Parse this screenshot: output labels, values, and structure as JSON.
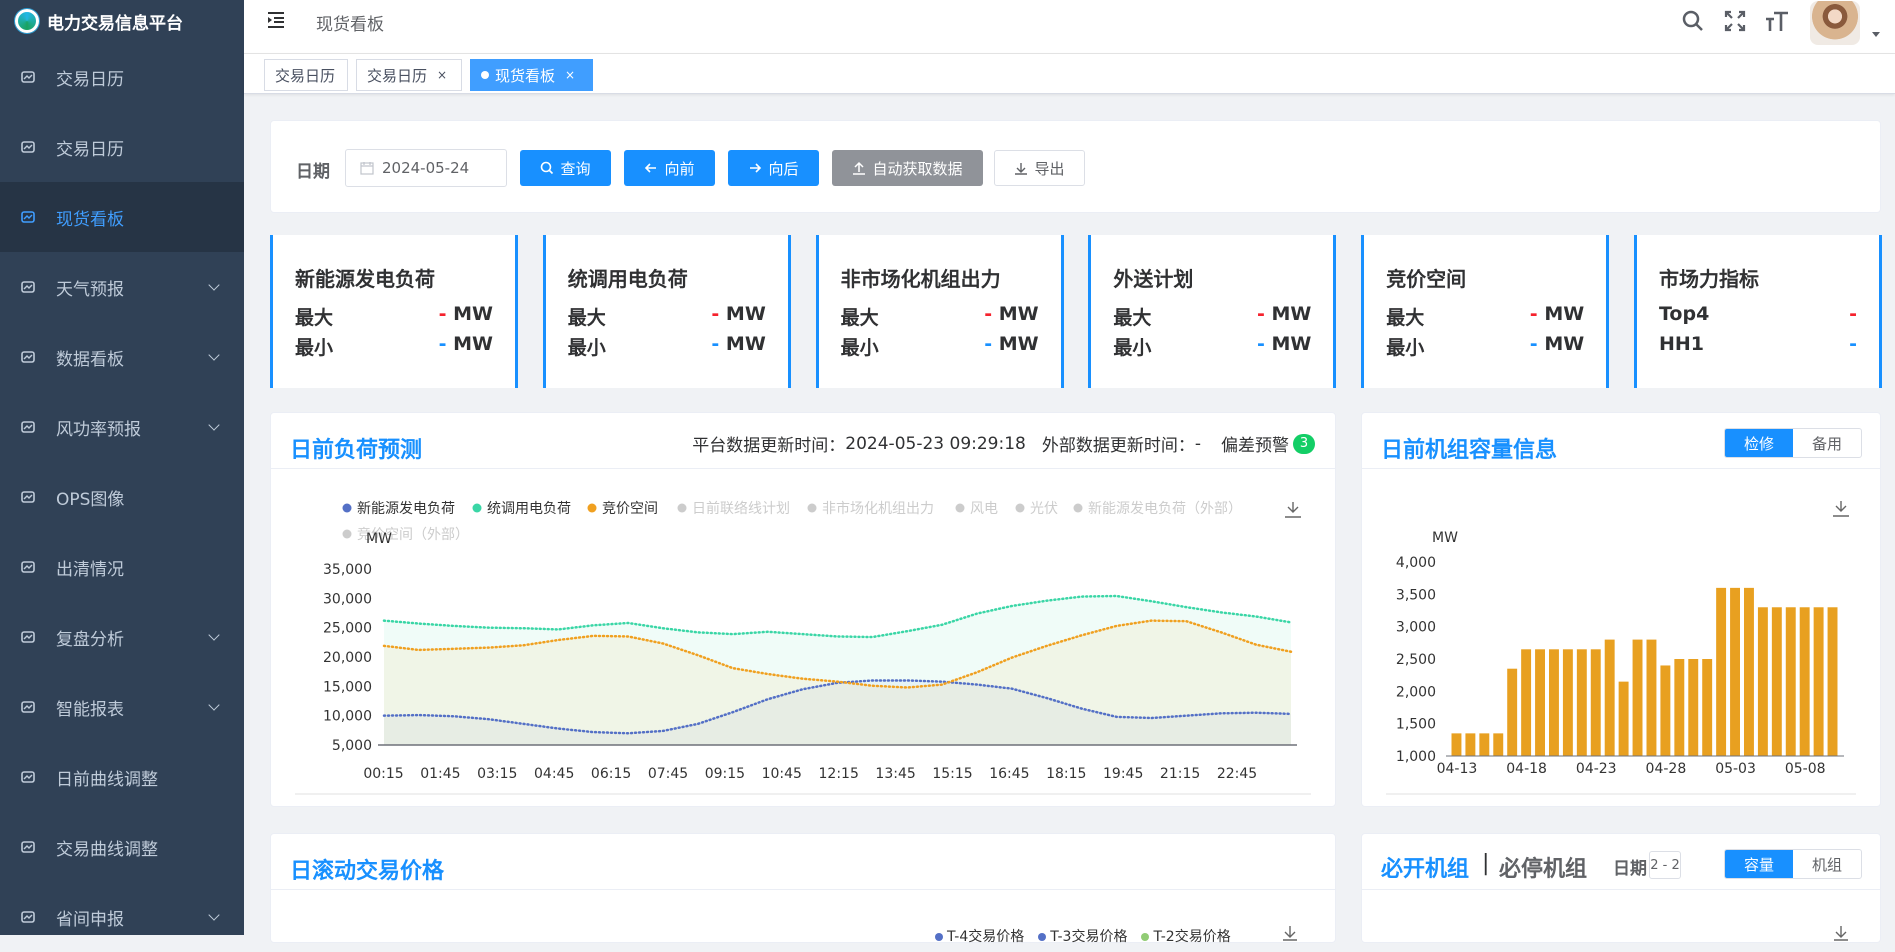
{
  "app": {
    "title": "电力交易信息平台"
  },
  "sidebar": {
    "items": [
      {
        "label": "交易日历",
        "icon": "dashboard-icon",
        "expandable": false
      },
      {
        "label": "交易日历",
        "icon": "calendar-icon",
        "expandable": false
      },
      {
        "label": "现货看板",
        "icon": "image-icon",
        "expandable": false,
        "active": true
      },
      {
        "label": "天气预报",
        "icon": "send-icon",
        "expandable": true
      },
      {
        "label": "数据看板",
        "icon": "list-icon",
        "expandable": true
      },
      {
        "label": "风功率预报",
        "icon": "globe-icon",
        "expandable": true
      },
      {
        "label": "OPS图像",
        "icon": "document-icon",
        "expandable": false
      },
      {
        "label": "出清情况",
        "icon": "checkbox-icon",
        "expandable": false
      },
      {
        "label": "复盘分析",
        "icon": "tree-icon",
        "expandable": true
      },
      {
        "label": "智能报表",
        "icon": "report-icon",
        "expandable": true
      },
      {
        "label": "日前曲线调整",
        "icon": "bar-chart-icon",
        "expandable": false
      },
      {
        "label": "交易曲线调整",
        "icon": "bar-chart-icon",
        "expandable": false
      },
      {
        "label": "省间申报",
        "icon": "table-icon",
        "expandable": true
      }
    ]
  },
  "header": {
    "breadcrumb": "现货看板"
  },
  "tags": [
    {
      "label": "交易日历",
      "closable": false
    },
    {
      "label": "交易日历",
      "closable": true
    },
    {
      "label": "现货看板",
      "closable": true,
      "active": true
    }
  ],
  "filter": {
    "date_label": "日期",
    "date_value": "2024-05-24",
    "query": "查询",
    "prev": "向前",
    "next": "向后",
    "auto_fetch": "自动获取数据",
    "export": "导出"
  },
  "stats": [
    {
      "title": "新能源发电负荷",
      "r1": "最大",
      "r1v": "-",
      "r2": "最小",
      "r2v": "-",
      "unit": "MW"
    },
    {
      "title": "统调用电负荷",
      "r1": "最大",
      "r1v": "-",
      "r2": "最小",
      "r2v": "-",
      "unit": "MW"
    },
    {
      "title": "非市场化机组出力",
      "r1": "最大",
      "r1v": "-",
      "r2": "最小",
      "r2v": "-",
      "unit": "MW"
    },
    {
      "title": "外送计划",
      "r1": "最大",
      "r1v": "-",
      "r2": "最小",
      "r2v": "-",
      "unit": "MW"
    },
    {
      "title": "竞价空间",
      "r1": "最大",
      "r1v": "-",
      "r2": "最小",
      "r2v": "-",
      "unit": "MW"
    },
    {
      "title": "市场力指标",
      "r1": "Top4",
      "r1v": "-",
      "r2": "HH1",
      "r2v": "-",
      "unit": ""
    }
  ],
  "load_panel": {
    "title": "日前负荷预测",
    "update_label": "平台数据更新时间：",
    "update_time": "2024-05-23 09:29:18",
    "ext_label": "外部数据更新时间：",
    "ext_time": "-",
    "warn_label": "偏差预警",
    "warn_count": "3"
  },
  "capacity_panel": {
    "title": "日前机组容量信息",
    "seg": [
      "检修",
      "备用"
    ]
  },
  "price_panel": {
    "title": "日滚动交易价格",
    "legend": [
      "T-4交易价格",
      "T-3交易价格",
      "T-2交易价格"
    ]
  },
  "unit_panel": {
    "title_a": "必开机组",
    "sep": "|",
    "title_b": "必停机组",
    "date_label": "日期",
    "date_value": "2 - 2",
    "seg": [
      "容量",
      "机组"
    ]
  },
  "chart_data": [
    {
      "type": "line",
      "ylabel": "MW",
      "ylim": [
        5000,
        35000
      ],
      "yticks": [
        "5,000",
        "10,000",
        "15,000",
        "20,000",
        "25,000",
        "30,000",
        "35,000"
      ],
      "x_ticks": [
        "00:15",
        "01:45",
        "03:15",
        "04:45",
        "06:15",
        "07:45",
        "09:15",
        "10:45",
        "12:15",
        "13:45",
        "15:15",
        "16:45",
        "18:15",
        "19:45",
        "21:15",
        "22:45"
      ],
      "legend": [
        {
          "name": "新能源发电负荷",
          "color": "#5470c6",
          "active": true
        },
        {
          "name": "统调用电负荷",
          "color": "#3ad6a6",
          "active": true
        },
        {
          "name": "竞价空间",
          "color": "#f0a020",
          "active": true
        },
        {
          "name": "日前联络线计划",
          "color": "#cccccc",
          "active": false
        },
        {
          "name": "非市场化机组出力",
          "color": "#cccccc",
          "active": false
        },
        {
          "name": "风电",
          "color": "#cccccc",
          "active": false
        },
        {
          "name": "光伏",
          "color": "#cccccc",
          "active": false
        },
        {
          "name": "新能源发电负荷（外部）",
          "color": "#cccccc",
          "active": false
        },
        {
          "name": "竞价空间（外部）",
          "color": "#cccccc",
          "active": false
        }
      ],
      "series": [
        {
          "name": "新能源发电负荷",
          "color": "#5470c6",
          "values": [
            10000,
            10100,
            9900,
            9400,
            8600,
            7800,
            7200,
            7000,
            7400,
            8600,
            10600,
            12800,
            14500,
            15600,
            16000,
            16000,
            15800,
            15300,
            14600,
            13000,
            11200,
            9800,
            9600,
            10000,
            10400,
            10500,
            10300
          ]
        },
        {
          "name": "统调用电负荷",
          "color": "#3ad6a6",
          "values": [
            26200,
            25700,
            25300,
            25000,
            24900,
            24700,
            25400,
            25800,
            24900,
            24200,
            23900,
            24300,
            23900,
            23500,
            23400,
            24400,
            25500,
            27400,
            28700,
            29600,
            30300,
            30400,
            29500,
            28500,
            27600,
            26900,
            25900
          ]
        },
        {
          "name": "竞价空间",
          "color": "#f0a020",
          "values": [
            21900,
            21200,
            21400,
            21600,
            22000,
            22900,
            23600,
            23500,
            22300,
            20300,
            18100,
            17100,
            16300,
            15800,
            15100,
            14800,
            15300,
            17400,
            19900,
            21900,
            23700,
            25300,
            26200,
            26100,
            24200,
            22100,
            20900
          ]
        }
      ]
    },
    {
      "type": "bar",
      "ylabel": "MW",
      "ylim": [
        1000,
        4000
      ],
      "yticks": [
        "1,000",
        "1,500",
        "2,000",
        "2,500",
        "3,000",
        "3,500",
        "4,000"
      ],
      "x_ticks": [
        "04-13",
        "04-18",
        "04-23",
        "04-28",
        "05-03",
        "05-08"
      ],
      "color": "#e8a020",
      "values": [
        1350,
        1350,
        1350,
        1350,
        2350,
        2650,
        2650,
        2650,
        2650,
        2650,
        2650,
        2800,
        2150,
        2800,
        2800,
        2400,
        2500,
        2500,
        2500,
        3600,
        3600,
        3600,
        3300,
        3300,
        3300,
        3300,
        3300,
        3300
      ]
    }
  ]
}
